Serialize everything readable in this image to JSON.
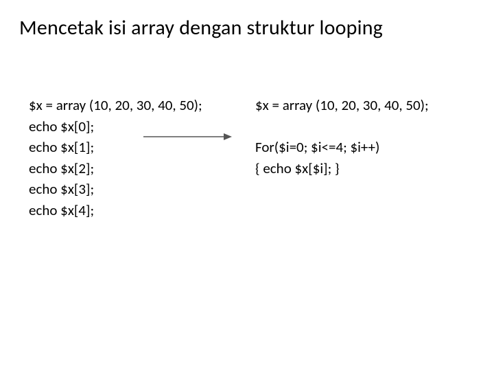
{
  "title": "Mencetak isi array dengan struktur looping",
  "left": {
    "l1": "$x = array (10, 20, 30, 40, 50);",
    "l2": "echo $x[0];",
    "l3": "echo $x[1];",
    "l4": "echo $x[2];",
    "l5": "echo $x[3];",
    "l6": "echo $x[4];"
  },
  "right": {
    "r1": "$x = array (10, 20, 30, 40, 50);",
    "r2": "",
    "r3": "For($i=0; $i<=4; $i++)",
    "r4": "{ echo $x[$i]; }"
  }
}
